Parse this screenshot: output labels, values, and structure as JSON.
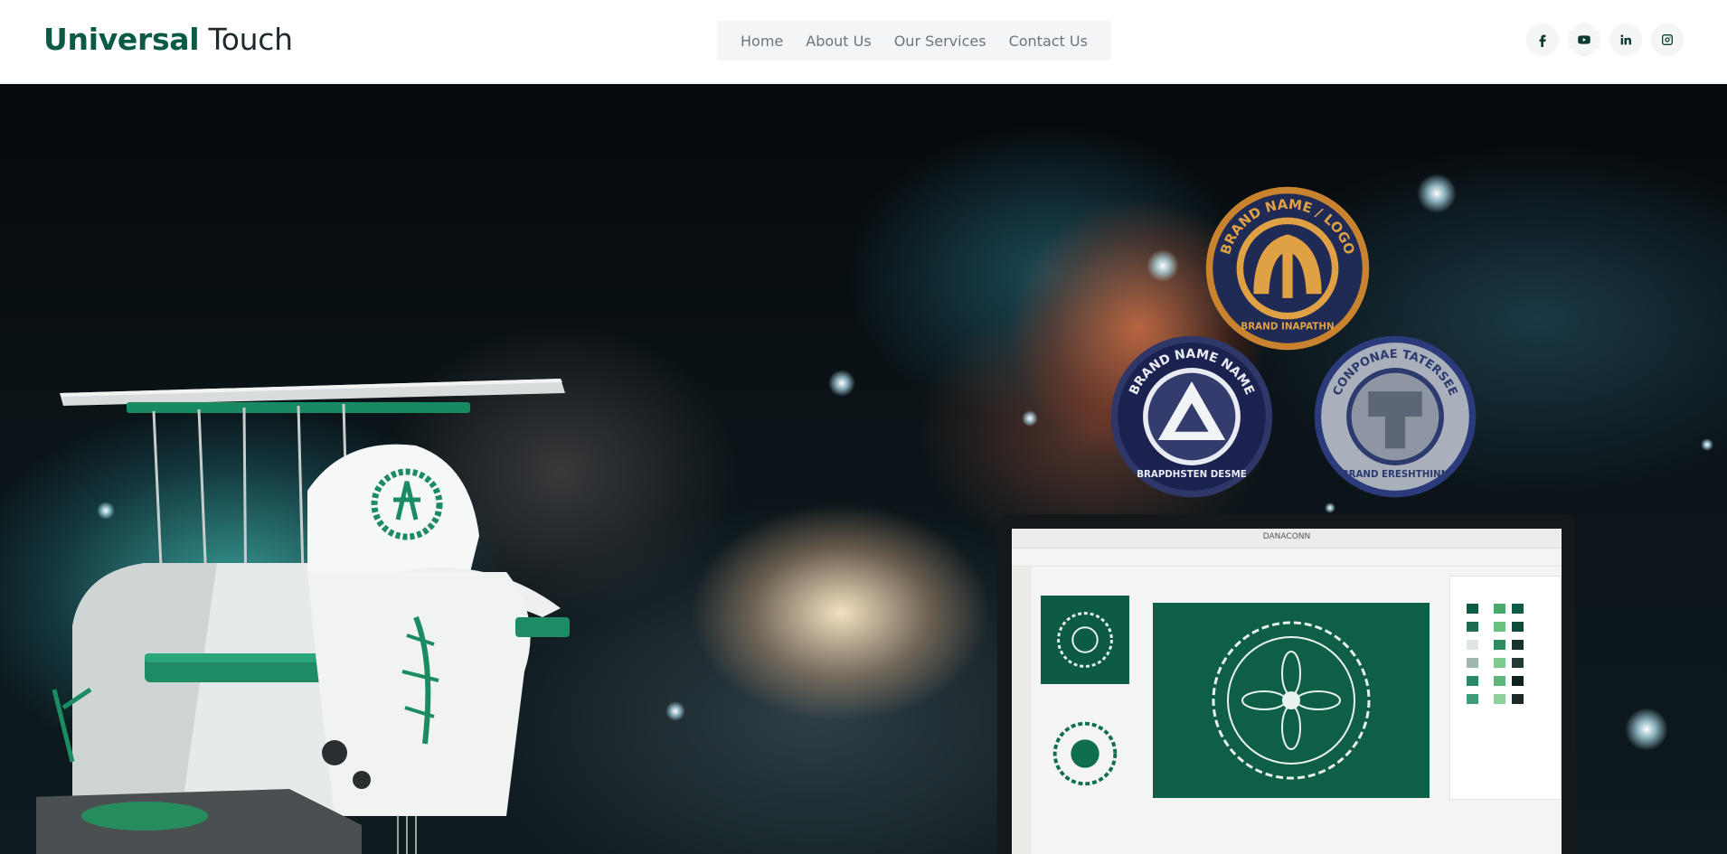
{
  "header": {
    "brand_strong": "Universal",
    "brand_light": "Touch",
    "nav": [
      "Home",
      "About Us",
      "Our Services",
      "Contact Us"
    ],
    "social": [
      "facebook-icon",
      "youtube-icon",
      "linkedin-icon",
      "instagram-icon"
    ]
  },
  "hero": {
    "patches": {
      "top": {
        "ring_text": "BRAND NAME / LOGO",
        "bottom_text": "BRAND INAPATHN"
      },
      "left": {
        "ring_text": "BRAND NAME NAME",
        "bottom_text": "BRAPDHSTEN DESME"
      },
      "right": {
        "ring_text": "CONPONAE TATERSEE",
        "bottom_text": "BRAND ERESHTHINN"
      }
    },
    "laptop_title": "DANACONN"
  },
  "colors": {
    "brand_green": "#0b5a46",
    "nav_bg": "#f3f5f7",
    "nav_text": "#6b7580",
    "icon_color": "#0d3b30",
    "patch_navy": "#1f2a55",
    "patch_gold": "#e0a044"
  }
}
